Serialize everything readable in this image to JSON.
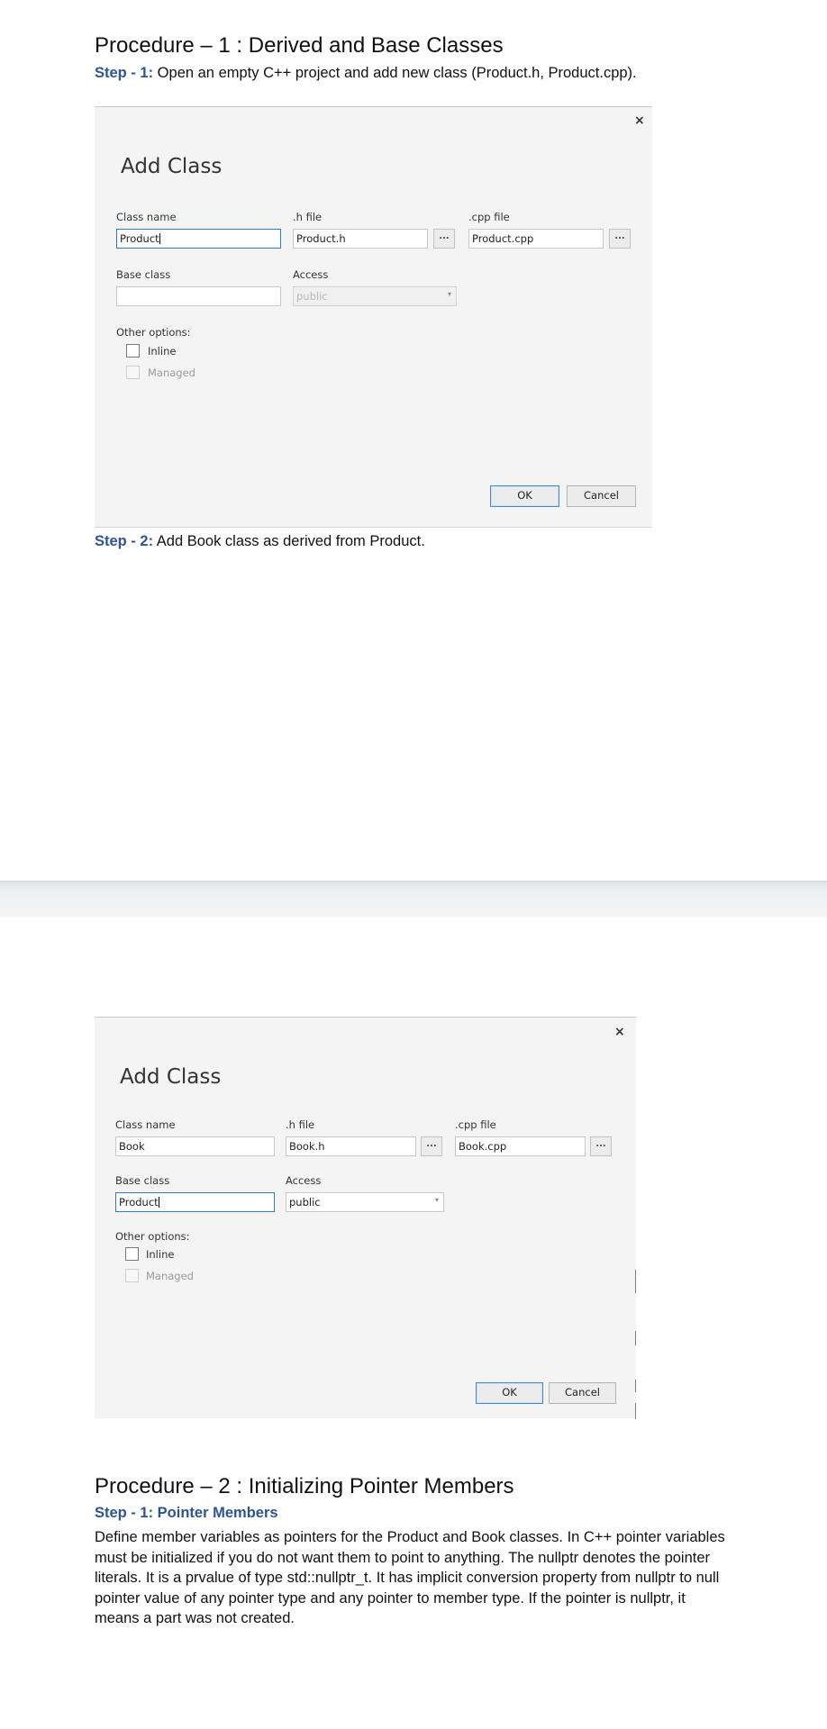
{
  "procedure1": {
    "heading": "Procedure – 1 :  Derived and Base Classes",
    "step1_label": "Step - 1:",
    "step1_text": " Open an empty C++ project and add new class (Product.h, Product.cpp).",
    "step2_label": "Step - 2:",
    "step2_text": " Add Book class as derived from Product."
  },
  "dialog1": {
    "close_glyph": "×",
    "title": "Add Class",
    "class_name_label": "Class name",
    "class_name_value": "Product",
    "h_file_label": ".h file",
    "h_file_value": "Product.h",
    "cpp_file_label": ".cpp file",
    "cpp_file_value": "Product.cpp",
    "browse_glyph": "...",
    "base_class_label": "Base class",
    "base_class_value": "",
    "access_label": "Access",
    "access_value": "public",
    "other_options_label": "Other options:",
    "inline_label": "Inline",
    "managed_label": "Managed",
    "ok_label": "OK",
    "cancel_label": "Cancel"
  },
  "dialog2": {
    "close_glyph": "×",
    "title": "Add Class",
    "class_name_label": "Class name",
    "class_name_value": "Book",
    "h_file_label": ".h file",
    "h_file_value": "Book.h",
    "cpp_file_label": ".cpp file",
    "cpp_file_value": "Book.cpp",
    "browse_glyph": "...",
    "base_class_label": "Base class",
    "base_class_value": "Product",
    "access_label": "Access",
    "access_value": "public",
    "other_options_label": "Other options:",
    "inline_label": "Inline",
    "managed_label": "Managed",
    "ok_label": "OK",
    "cancel_label": "Cancel"
  },
  "procedure2": {
    "heading": "Procedure – 2 :  Initializing Pointer Members",
    "step1_label": "Step - 1: Pointer Members",
    "paragraph_lines": [
      "Define member variables as pointers for the Product and Book classes. In C++ pointer variables",
      "must be initialized if you do not want them to point to anything. The nullptr denotes the pointer",
      "literals. It is a prvalue of type std::nullptr_t. It has implicit conversion property from nullptr to null",
      "pointer value of any pointer type and any pointer to member type. If the pointer is nullptr, it",
      "means a part was not created."
    ]
  }
}
